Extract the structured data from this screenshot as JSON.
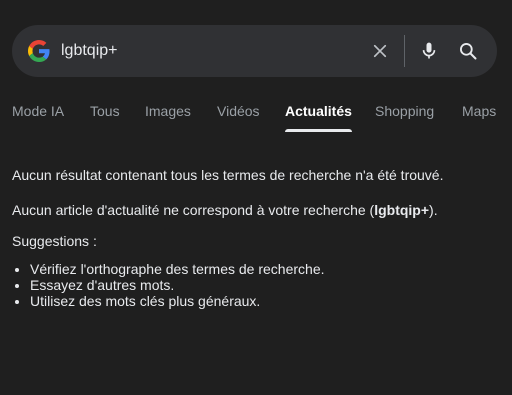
{
  "search": {
    "query": "lgbtqip+",
    "clear_icon": "close-icon",
    "mic_icon": "microphone-icon",
    "search_icon": "magnifier-icon"
  },
  "tabs": [
    {
      "label": "Mode IA",
      "active": false
    },
    {
      "label": "Tous",
      "active": false
    },
    {
      "label": "Images",
      "active": false
    },
    {
      "label": "Vidéos",
      "active": false
    },
    {
      "label": "Actualités",
      "active": true
    },
    {
      "label": "Shopping",
      "active": false
    },
    {
      "label": "Maps",
      "active": false
    }
  ],
  "results": {
    "no_results": "Aucun résultat contenant tous les termes de recherche n'a été trouvé.",
    "no_news_prefix": "Aucun article d'actualité ne correspond à votre recherche (",
    "no_news_query": "lgbtqip+",
    "no_news_suffix": ").",
    "suggestions_title": "Suggestions :",
    "suggestions": [
      "Vérifiez l'orthographe des termes de recherche.",
      "Essayez d'autres mots.",
      "Utilisez des mots clés plus généraux."
    ]
  },
  "colors": {
    "background": "#1f1f1f",
    "search_bar": "#303134",
    "text": "#e8eaed",
    "muted": "#9aa0a6"
  }
}
